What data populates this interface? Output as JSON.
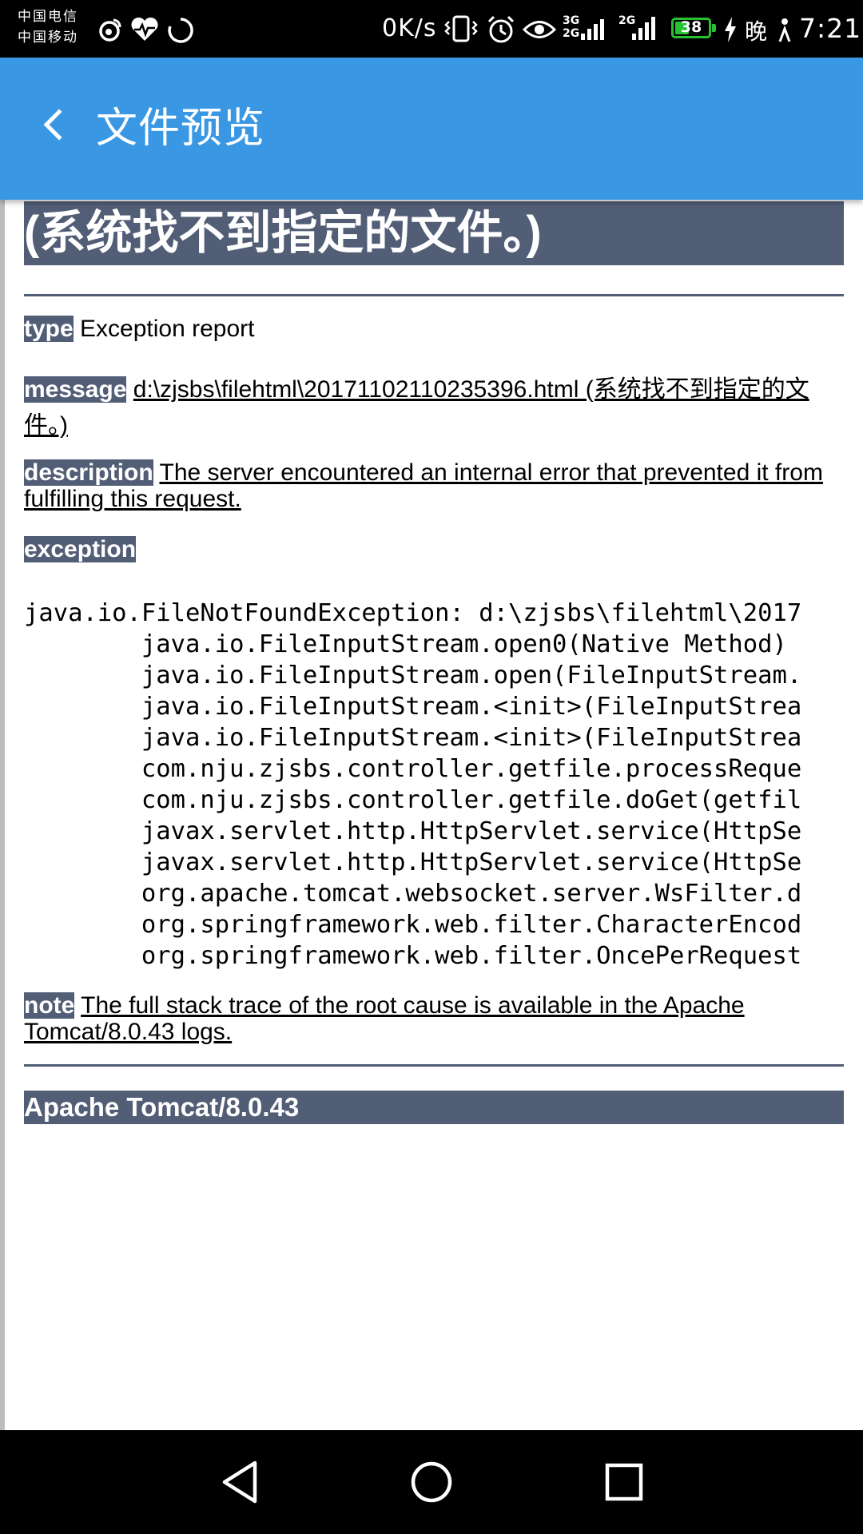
{
  "status_bar": {
    "carrier_1": "中国电信",
    "carrier_2": "中国移动",
    "net_speed": "0K/s",
    "net_3g_4g": "3G",
    "net_2g_top": "2G",
    "net_2g": "2G",
    "battery_level": "38",
    "evening_label": "晚",
    "time": "7:21",
    "battery_color": "#27c234"
  },
  "app_bar": {
    "title": "文件预览",
    "back_icon": "chevron-left-icon",
    "color": "#3a97e4"
  },
  "page": {
    "heading": "(系统找不到指定的文件。)",
    "type_label": "type",
    "type_value": "Exception report",
    "message_label": "message",
    "message_value": "d:\\zjsbs\\filehtml\\20171102110235396.html (系统找不到指定的文件。)",
    "description_label": "description",
    "description_value": "The server encountered an internal error that prevented it from fulfilling this request.",
    "exception_label": "exception",
    "stack_trace": [
      "java.io.FileNotFoundException: d:\\zjsbs\\filehtml\\2017",
      "\tjava.io.FileInputStream.open0(Native Method)",
      "\tjava.io.FileInputStream.open(FileInputStream.",
      "\tjava.io.FileInputStream.<init>(FileInputStrea",
      "\tjava.io.FileInputStream.<init>(FileInputStrea",
      "\tcom.nju.zjsbs.controller.getfile.processReque",
      "\tcom.nju.zjsbs.controller.getfile.doGet(getfil",
      "\tjavax.servlet.http.HttpServlet.service(HttpSe",
      "\tjavax.servlet.http.HttpServlet.service(HttpSe",
      "\torg.apache.tomcat.websocket.server.WsFilter.d",
      "\torg.springframework.web.filter.CharacterEncod",
      "\torg.springframework.web.filter.OncePerRequest"
    ],
    "note_label": "note",
    "note_value": "The full stack trace of the root cause is available in the Apache Tomcat/8.0.43 logs.",
    "footer": "Apache Tomcat/8.0.43",
    "accent_color": "#525d76"
  },
  "nav_bar": {
    "back_icon": "triangle-back-icon",
    "home_icon": "circle-home-icon",
    "recents_icon": "square-recents-icon"
  }
}
